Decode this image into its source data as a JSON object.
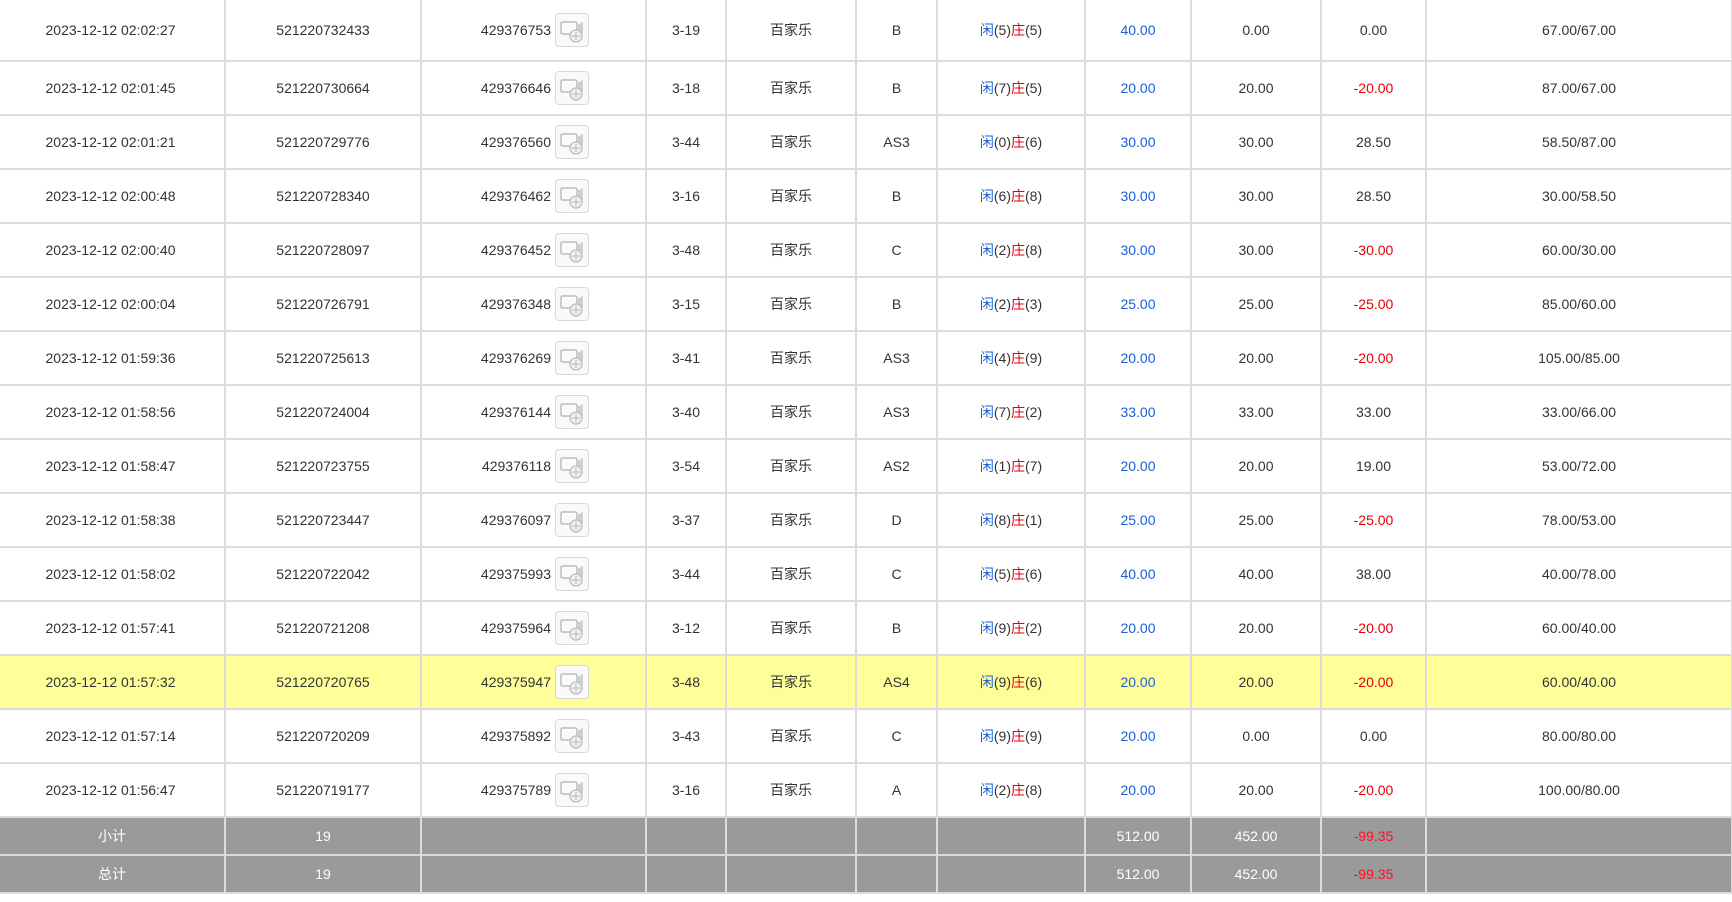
{
  "rows": [
    {
      "time": "2023-12-12 02:02:27",
      "bet_id": "521220732433",
      "game_id": "429376753",
      "round": "3-19",
      "game": "百家乐",
      "table": "B",
      "player_label": "闲",
      "player": "(5)",
      "banker_label": "庄",
      "banker": "(5)",
      "bet": "40.00",
      "valid": "0.00",
      "winloss": "0.00",
      "winloss_neg": false,
      "balance": "67.00/67.00"
    },
    {
      "time": "2023-12-12 02:01:45",
      "bet_id": "521220730664",
      "game_id": "429376646",
      "round": "3-18",
      "game": "百家乐",
      "table": "B",
      "player_label": "闲",
      "player": "(7)",
      "banker_label": "庄",
      "banker": "(5)",
      "bet": "20.00",
      "valid": "20.00",
      "winloss": "-20.00",
      "winloss_neg": true,
      "balance": "87.00/67.00"
    },
    {
      "time": "2023-12-12 02:01:21",
      "bet_id": "521220729776",
      "game_id": "429376560",
      "round": "3-44",
      "game": "百家乐",
      "table": "AS3",
      "player_label": "闲",
      "player": "(0)",
      "banker_label": "庄",
      "banker": "(6)",
      "bet": "30.00",
      "valid": "30.00",
      "winloss": "28.50",
      "winloss_neg": false,
      "balance": "58.50/87.00"
    },
    {
      "time": "2023-12-12 02:00:48",
      "bet_id": "521220728340",
      "game_id": "429376462",
      "round": "3-16",
      "game": "百家乐",
      "table": "B",
      "player_label": "闲",
      "player": "(6)",
      "banker_label": "庄",
      "banker": "(8)",
      "bet": "30.00",
      "valid": "30.00",
      "winloss": "28.50",
      "winloss_neg": false,
      "balance": "30.00/58.50"
    },
    {
      "time": "2023-12-12 02:00:40",
      "bet_id": "521220728097",
      "game_id": "429376452",
      "round": "3-48",
      "game": "百家乐",
      "table": "C",
      "player_label": "闲",
      "player": "(2)",
      "banker_label": "庄",
      "banker": "(8)",
      "bet": "30.00",
      "valid": "30.00",
      "winloss": "-30.00",
      "winloss_neg": true,
      "balance": "60.00/30.00"
    },
    {
      "time": "2023-12-12 02:00:04",
      "bet_id": "521220726791",
      "game_id": "429376348",
      "round": "3-15",
      "game": "百家乐",
      "table": "B",
      "player_label": "闲",
      "player": "(2)",
      "banker_label": "庄",
      "banker": "(3)",
      "bet": "25.00",
      "valid": "25.00",
      "winloss": "-25.00",
      "winloss_neg": true,
      "balance": "85.00/60.00"
    },
    {
      "time": "2023-12-12 01:59:36",
      "bet_id": "521220725613",
      "game_id": "429376269",
      "round": "3-41",
      "game": "百家乐",
      "table": "AS3",
      "player_label": "闲",
      "player": "(4)",
      "banker_label": "庄",
      "banker": "(9)",
      "bet": "20.00",
      "valid": "20.00",
      "winloss": "-20.00",
      "winloss_neg": true,
      "balance": "105.00/85.00"
    },
    {
      "time": "2023-12-12 01:58:56",
      "bet_id": "521220724004",
      "game_id": "429376144",
      "round": "3-40",
      "game": "百家乐",
      "table": "AS3",
      "player_label": "闲",
      "player": "(7)",
      "banker_label": "庄",
      "banker": "(2)",
      "bet": "33.00",
      "valid": "33.00",
      "winloss": "33.00",
      "winloss_neg": false,
      "balance": "33.00/66.00"
    },
    {
      "time": "2023-12-12 01:58:47",
      "bet_id": "521220723755",
      "game_id": "429376118",
      "round": "3-54",
      "game": "百家乐",
      "table": "AS2",
      "player_label": "闲",
      "player": "(1)",
      "banker_label": "庄",
      "banker": "(7)",
      "bet": "20.00",
      "valid": "20.00",
      "winloss": "19.00",
      "winloss_neg": false,
      "balance": "53.00/72.00"
    },
    {
      "time": "2023-12-12 01:58:38",
      "bet_id": "521220723447",
      "game_id": "429376097",
      "round": "3-37",
      "game": "百家乐",
      "table": "D",
      "player_label": "闲",
      "player": "(8)",
      "banker_label": "庄",
      "banker": "(1)",
      "bet": "25.00",
      "valid": "25.00",
      "winloss": "-25.00",
      "winloss_neg": true,
      "balance": "78.00/53.00"
    },
    {
      "time": "2023-12-12 01:58:02",
      "bet_id": "521220722042",
      "game_id": "429375993",
      "round": "3-44",
      "game": "百家乐",
      "table": "C",
      "player_label": "闲",
      "player": "(5)",
      "banker_label": "庄",
      "banker": "(6)",
      "bet": "40.00",
      "valid": "40.00",
      "winloss": "38.00",
      "winloss_neg": false,
      "balance": "40.00/78.00"
    },
    {
      "time": "2023-12-12 01:57:41",
      "bet_id": "521220721208",
      "game_id": "429375964",
      "round": "3-12",
      "game": "百家乐",
      "table": "B",
      "player_label": "闲",
      "player": "(9)",
      "banker_label": "庄",
      "banker": "(2)",
      "bet": "20.00",
      "valid": "20.00",
      "winloss": "-20.00",
      "winloss_neg": true,
      "balance": "60.00/40.00"
    },
    {
      "time": "2023-12-12 01:57:32",
      "bet_id": "521220720765",
      "game_id": "429375947",
      "round": "3-48",
      "game": "百家乐",
      "table": "AS4",
      "player_label": "闲",
      "player": "(9)",
      "banker_label": "庄",
      "banker": "(6)",
      "bet": "20.00",
      "valid": "20.00",
      "winloss": "-20.00",
      "winloss_neg": true,
      "balance": "60.00/40.00",
      "highlight": true
    },
    {
      "time": "2023-12-12 01:57:14",
      "bet_id": "521220720209",
      "game_id": "429375892",
      "round": "3-43",
      "game": "百家乐",
      "table": "C",
      "player_label": "闲",
      "player": "(9)",
      "banker_label": "庄",
      "banker": "(9)",
      "bet": "20.00",
      "valid": "0.00",
      "winloss": "0.00",
      "winloss_neg": false,
      "balance": "80.00/80.00"
    },
    {
      "time": "2023-12-12 01:56:47",
      "bet_id": "521220719177",
      "game_id": "429375789",
      "round": "3-16",
      "game": "百家乐",
      "table": "A",
      "player_label": "闲",
      "player": "(2)",
      "banker_label": "庄",
      "banker": "(8)",
      "bet": "20.00",
      "valid": "20.00",
      "winloss": "-20.00",
      "winloss_neg": true,
      "balance": "100.00/80.00"
    }
  ],
  "subtotal": {
    "label": "小计",
    "count": "19",
    "bet": "512.00",
    "valid": "452.00",
    "winloss": "-99.35"
  },
  "total": {
    "label": "总计",
    "count": "19",
    "bet": "512.00",
    "valid": "452.00",
    "winloss": "-99.35"
  },
  "colors": {
    "blue": "#1a5fd6",
    "red": "#e0000d",
    "highlight": "#ffff99",
    "total_bg": "#9a9a9a"
  },
  "icons": {
    "video": "video-replay-icon"
  }
}
